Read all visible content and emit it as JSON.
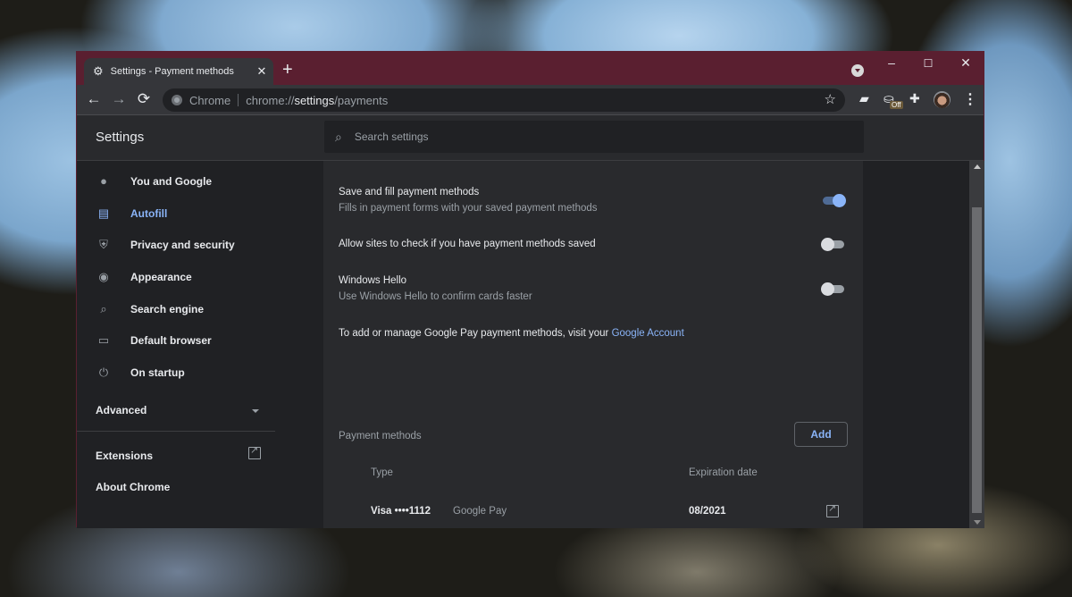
{
  "browser": {
    "tab_title": "Settings - Payment methods",
    "new_tab_label": "+",
    "omnibox_chip": "Chrome",
    "url_prefix": "chrome://",
    "url_highlight": "settings",
    "url_suffix": "/payments",
    "extension_badge": "Off",
    "window_controls": {
      "minimize": "–",
      "maximize": "☐",
      "close": "✕"
    },
    "nav": {
      "back": "←",
      "forward": "→",
      "reload": "⟳"
    },
    "icons": [
      "gear-icon",
      "star-icon",
      "note-icon",
      "battery-extension-icon",
      "puzzle-icon",
      "avatar",
      "more-vert-icon"
    ]
  },
  "settings": {
    "title": "Settings",
    "search_placeholder": "Search settings"
  },
  "sidebar": {
    "items": [
      {
        "label": "You and Google",
        "icon": "person-icon",
        "active": false
      },
      {
        "label": "Autofill",
        "icon": "clipboard-icon",
        "active": true
      },
      {
        "label": "Privacy and security",
        "icon": "shield-icon",
        "active": false
      },
      {
        "label": "Appearance",
        "icon": "palette-icon",
        "active": false
      },
      {
        "label": "Search engine",
        "icon": "search-icon",
        "active": false
      },
      {
        "label": "Default browser",
        "icon": "browser-icon",
        "active": false
      },
      {
        "label": "On startup",
        "icon": "power-icon",
        "active": false
      }
    ],
    "advanced": "Advanced",
    "extensions": "Extensions",
    "about": "About Chrome"
  },
  "payments": {
    "save_fill": {
      "title": "Save and fill payment methods",
      "subtitle": "Fills in payment forms with your saved payment methods",
      "enabled": true
    },
    "allow_check": {
      "title": "Allow sites to check if you have payment methods saved",
      "enabled": false
    },
    "windows_hello": {
      "title": "Windows Hello",
      "subtitle": "Use Windows Hello to confirm cards faster",
      "enabled": false
    },
    "google_pay_text": "To add or manage Google Pay payment methods, visit your ",
    "google_pay_link": "Google Account",
    "section_label": "Payment methods",
    "add_label": "Add",
    "columns": {
      "type": "Type",
      "expiration": "Expiration date"
    },
    "cards": [
      {
        "type": "Visa ••••1112",
        "source": "Google Pay",
        "expiration": "08/2021"
      }
    ]
  },
  "colors": {
    "title_bar": "#5a1f30",
    "accent": "#8ab4f8",
    "surface": "#292a2d",
    "background": "#202124"
  }
}
